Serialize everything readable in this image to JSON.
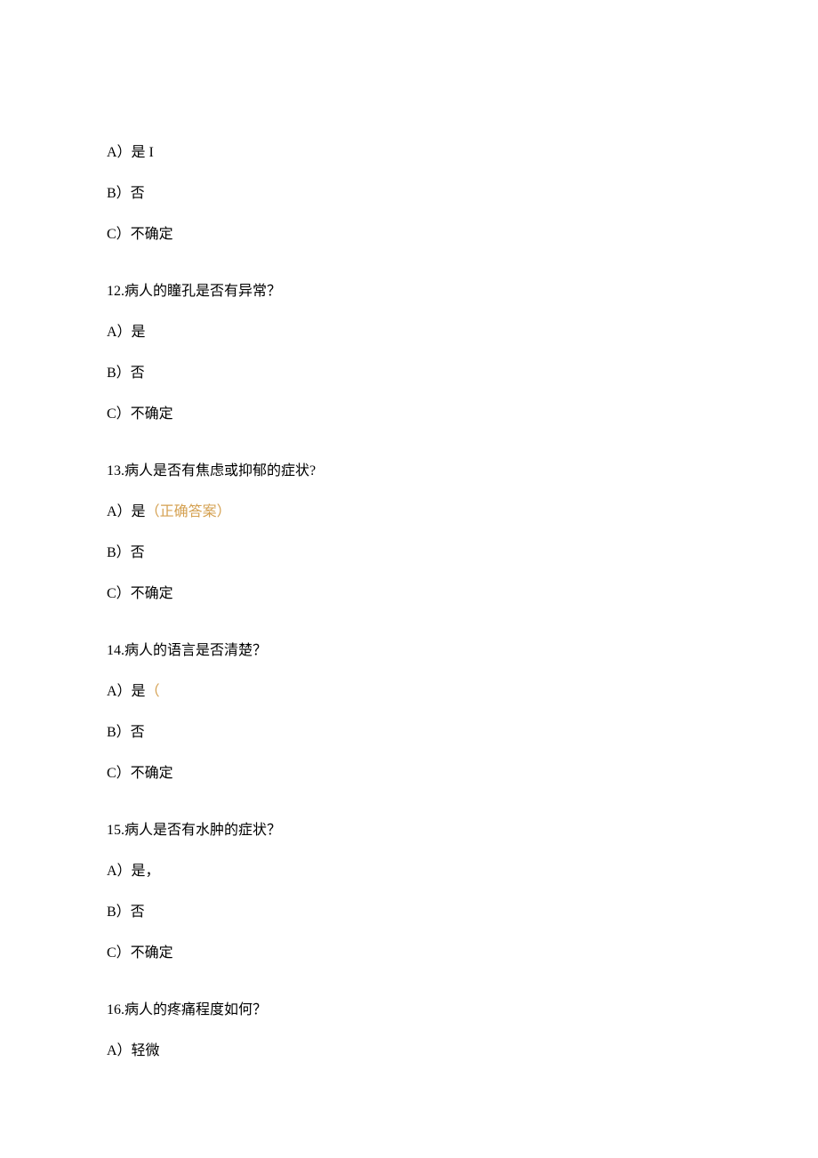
{
  "blocks": [
    {
      "type": "option",
      "text": "A）是 I"
    },
    {
      "type": "option",
      "text": "B）否"
    },
    {
      "type": "option",
      "text": "C）不确定"
    },
    {
      "type": "question",
      "text": "12.病人的瞳孔是否有异常？"
    },
    {
      "type": "option",
      "text": "A）是"
    },
    {
      "type": "option",
      "text": "B）否"
    },
    {
      "type": "option",
      "text": "C）不确定"
    },
    {
      "type": "question",
      "text": "13.病人是否有焦虑或抑郁的症状?"
    },
    {
      "type": "option_with_answer",
      "prefix": "A）是",
      "answer": "（正确答案）"
    },
    {
      "type": "option",
      "text": "B）否"
    },
    {
      "type": "option",
      "text": "C）不确定"
    },
    {
      "type": "question",
      "text": "14.病人的语言是否清楚？"
    },
    {
      "type": "option_with_answer",
      "prefix": "A）是",
      "answer": "（"
    },
    {
      "type": "option",
      "text": "B）否"
    },
    {
      "type": "option",
      "text": "C）不确定"
    },
    {
      "type": "question",
      "text": "15.病人是否有水肿的症状？"
    },
    {
      "type": "option",
      "text": "A）是，"
    },
    {
      "type": "option",
      "text": "B）否"
    },
    {
      "type": "option",
      "text": "C）不确定"
    },
    {
      "type": "question",
      "text": "16.病人的疼痛程度如何？"
    },
    {
      "type": "option",
      "text": "A）轻微"
    }
  ]
}
